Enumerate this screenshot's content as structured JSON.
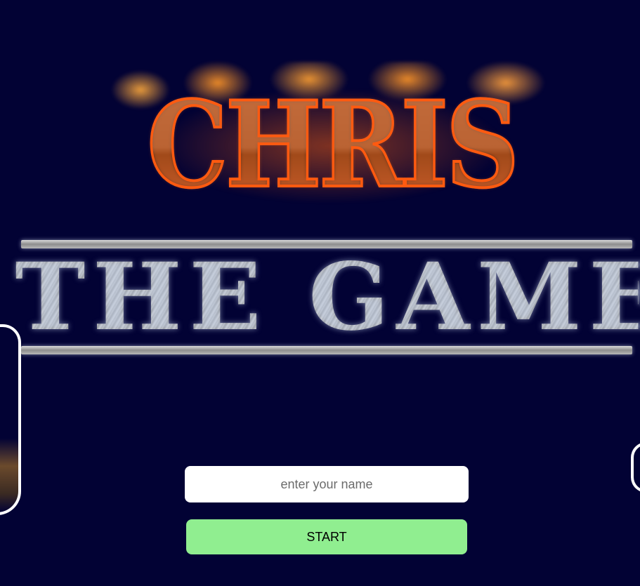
{
  "logo": {
    "line1": "CHRIS",
    "line2": "THE GAME"
  },
  "form": {
    "name_placeholder": "enter your name",
    "name_value": "",
    "start_label": "START"
  },
  "colors": {
    "background": "#020234",
    "start_button": "#90ee90",
    "input_background": "#ffffff",
    "fire_outline": "#ff5a10"
  }
}
